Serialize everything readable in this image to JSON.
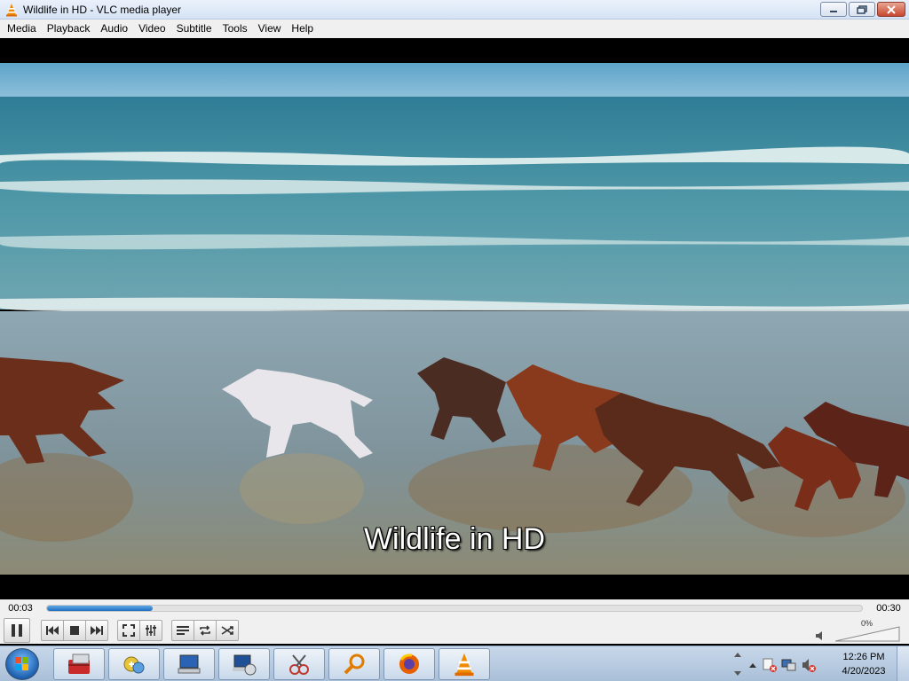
{
  "window": {
    "title": "Wildlife in HD - VLC media player"
  },
  "menu": [
    "Media",
    "Playback",
    "Audio",
    "Video",
    "Subtitle",
    "Tools",
    "View",
    "Help"
  ],
  "video": {
    "subtitle": "Wildlife in HD"
  },
  "seek": {
    "elapsed": "00:03",
    "total": "00:30",
    "progress": 0.13
  },
  "volume": {
    "percent": "0%"
  },
  "taskbar": {
    "apps": [
      "toolbox-icon",
      "control-panel-icon",
      "computer-icon",
      "network-icon",
      "snipping-tool-icon",
      "search-icon",
      "firefox-icon",
      "vlc-icon"
    ]
  },
  "clock": {
    "time": "12:26 PM",
    "date": "4/20/2023"
  },
  "colors": {
    "accent": "#1f6fc0",
    "vlc_orange": "#f08a00"
  }
}
